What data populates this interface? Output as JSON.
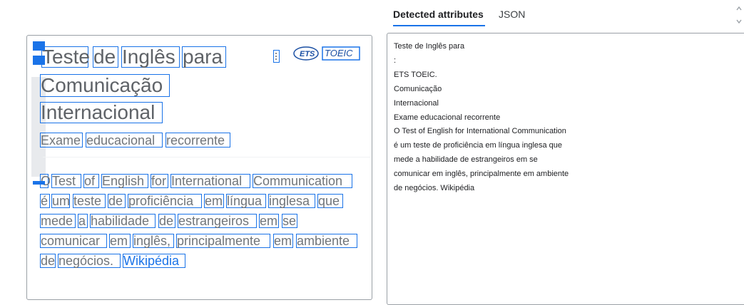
{
  "tabs": {
    "active": "Detected attributes",
    "inactive": "JSON"
  },
  "image": {
    "title_words": [
      "Teste",
      "de",
      "Inglês",
      "para",
      "Comunicação",
      "Internacional"
    ],
    "subtitle_words": [
      "Exame",
      "educacional",
      "recorrente"
    ],
    "logo": {
      "ets": "ETS",
      "toeic": "TOEIC"
    },
    "body_words": {
      "line1": [
        "O",
        "Test",
        "of",
        "English",
        "for",
        "International",
        "Communication"
      ],
      "line2": [
        "é",
        "um",
        "teste",
        "de",
        "proficiência",
        "em",
        "língua",
        "inglesa",
        "que"
      ],
      "line3": [
        "mede",
        "a",
        "habilidade",
        "de",
        "estrangeiros",
        "em",
        "se"
      ],
      "line4": [
        "comunicar",
        "em",
        "inglês,",
        "principalmente",
        "em",
        "ambiente"
      ],
      "line5": [
        "de",
        "negócios."
      ],
      "link": "Wikipédia"
    }
  },
  "detected_text": [
    "Teste de Inglês para",
    ":",
    "ETS TOEIC.",
    "Comunicação",
    "Internacional",
    "Exame educacional recorrente",
    "O Test of English for International Communication",
    "é um teste de proficiência em língua inglesa que",
    "mede a habilidade de estrangeiros em se",
    "comunicar em inglês, principalmente em ambiente",
    "de negócios. Wikipédia"
  ],
  "colors": {
    "accent": "#1a73e8",
    "text_gray": "#70757a",
    "border": "#9aa0a6"
  }
}
